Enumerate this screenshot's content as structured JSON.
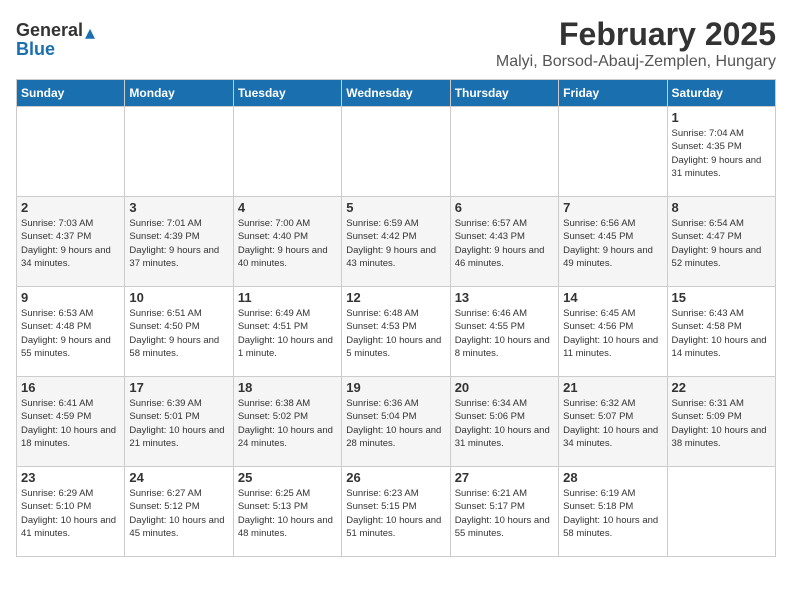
{
  "header": {
    "logo_general": "General",
    "logo_blue": "Blue",
    "month_year": "February 2025",
    "location": "Malyi, Borsod-Abauj-Zemplen, Hungary"
  },
  "weekdays": [
    "Sunday",
    "Monday",
    "Tuesday",
    "Wednesday",
    "Thursday",
    "Friday",
    "Saturday"
  ],
  "weeks": [
    [
      {
        "day": "",
        "info": ""
      },
      {
        "day": "",
        "info": ""
      },
      {
        "day": "",
        "info": ""
      },
      {
        "day": "",
        "info": ""
      },
      {
        "day": "",
        "info": ""
      },
      {
        "day": "",
        "info": ""
      },
      {
        "day": "1",
        "info": "Sunrise: 7:04 AM\nSunset: 4:35 PM\nDaylight: 9 hours and 31 minutes."
      }
    ],
    [
      {
        "day": "2",
        "info": "Sunrise: 7:03 AM\nSunset: 4:37 PM\nDaylight: 9 hours and 34 minutes."
      },
      {
        "day": "3",
        "info": "Sunrise: 7:01 AM\nSunset: 4:39 PM\nDaylight: 9 hours and 37 minutes."
      },
      {
        "day": "4",
        "info": "Sunrise: 7:00 AM\nSunset: 4:40 PM\nDaylight: 9 hours and 40 minutes."
      },
      {
        "day": "5",
        "info": "Sunrise: 6:59 AM\nSunset: 4:42 PM\nDaylight: 9 hours and 43 minutes."
      },
      {
        "day": "6",
        "info": "Sunrise: 6:57 AM\nSunset: 4:43 PM\nDaylight: 9 hours and 46 minutes."
      },
      {
        "day": "7",
        "info": "Sunrise: 6:56 AM\nSunset: 4:45 PM\nDaylight: 9 hours and 49 minutes."
      },
      {
        "day": "8",
        "info": "Sunrise: 6:54 AM\nSunset: 4:47 PM\nDaylight: 9 hours and 52 minutes."
      }
    ],
    [
      {
        "day": "9",
        "info": "Sunrise: 6:53 AM\nSunset: 4:48 PM\nDaylight: 9 hours and 55 minutes."
      },
      {
        "day": "10",
        "info": "Sunrise: 6:51 AM\nSunset: 4:50 PM\nDaylight: 9 hours and 58 minutes."
      },
      {
        "day": "11",
        "info": "Sunrise: 6:49 AM\nSunset: 4:51 PM\nDaylight: 10 hours and 1 minute."
      },
      {
        "day": "12",
        "info": "Sunrise: 6:48 AM\nSunset: 4:53 PM\nDaylight: 10 hours and 5 minutes."
      },
      {
        "day": "13",
        "info": "Sunrise: 6:46 AM\nSunset: 4:55 PM\nDaylight: 10 hours and 8 minutes."
      },
      {
        "day": "14",
        "info": "Sunrise: 6:45 AM\nSunset: 4:56 PM\nDaylight: 10 hours and 11 minutes."
      },
      {
        "day": "15",
        "info": "Sunrise: 6:43 AM\nSunset: 4:58 PM\nDaylight: 10 hours and 14 minutes."
      }
    ],
    [
      {
        "day": "16",
        "info": "Sunrise: 6:41 AM\nSunset: 4:59 PM\nDaylight: 10 hours and 18 minutes."
      },
      {
        "day": "17",
        "info": "Sunrise: 6:39 AM\nSunset: 5:01 PM\nDaylight: 10 hours and 21 minutes."
      },
      {
        "day": "18",
        "info": "Sunrise: 6:38 AM\nSunset: 5:02 PM\nDaylight: 10 hours and 24 minutes."
      },
      {
        "day": "19",
        "info": "Sunrise: 6:36 AM\nSunset: 5:04 PM\nDaylight: 10 hours and 28 minutes."
      },
      {
        "day": "20",
        "info": "Sunrise: 6:34 AM\nSunset: 5:06 PM\nDaylight: 10 hours and 31 minutes."
      },
      {
        "day": "21",
        "info": "Sunrise: 6:32 AM\nSunset: 5:07 PM\nDaylight: 10 hours and 34 minutes."
      },
      {
        "day": "22",
        "info": "Sunrise: 6:31 AM\nSunset: 5:09 PM\nDaylight: 10 hours and 38 minutes."
      }
    ],
    [
      {
        "day": "23",
        "info": "Sunrise: 6:29 AM\nSunset: 5:10 PM\nDaylight: 10 hours and 41 minutes."
      },
      {
        "day": "24",
        "info": "Sunrise: 6:27 AM\nSunset: 5:12 PM\nDaylight: 10 hours and 45 minutes."
      },
      {
        "day": "25",
        "info": "Sunrise: 6:25 AM\nSunset: 5:13 PM\nDaylight: 10 hours and 48 minutes."
      },
      {
        "day": "26",
        "info": "Sunrise: 6:23 AM\nSunset: 5:15 PM\nDaylight: 10 hours and 51 minutes."
      },
      {
        "day": "27",
        "info": "Sunrise: 6:21 AM\nSunset: 5:17 PM\nDaylight: 10 hours and 55 minutes."
      },
      {
        "day": "28",
        "info": "Sunrise: 6:19 AM\nSunset: 5:18 PM\nDaylight: 10 hours and 58 minutes."
      },
      {
        "day": "",
        "info": ""
      }
    ]
  ]
}
